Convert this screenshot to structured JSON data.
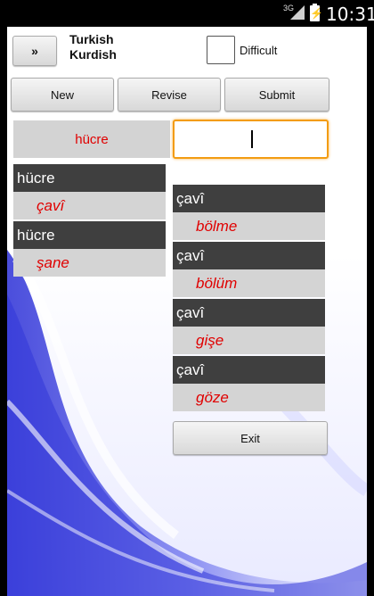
{
  "status_bar": {
    "network": "3G",
    "time": "10:31",
    "icons": [
      "signal-icon",
      "battery-charging-icon"
    ]
  },
  "header": {
    "nav_button_label": "»",
    "language_from": "Turkish",
    "language_to": "Kurdish",
    "difficult_label": "Difficult",
    "difficult_checked": false
  },
  "toolbar": {
    "new_label": "New",
    "revise_label": "Revise",
    "submit_label": "Submit"
  },
  "quiz": {
    "question": "hücre",
    "answer_value": ""
  },
  "left_list": [
    {
      "term": "hücre",
      "translation": "çavî"
    },
    {
      "term": "hücre",
      "translation": "şane"
    }
  ],
  "right_list": [
    {
      "term": "çavî",
      "translation": "bölme"
    },
    {
      "term": "çavî",
      "translation": "bölüm"
    },
    {
      "term": "çavî",
      "translation": "gişe"
    },
    {
      "term": "çavî",
      "translation": "göze"
    }
  ],
  "exit_label": "Exit",
  "colors": {
    "translation_text": "#e00000",
    "header_row_bg": "#3f3f3f",
    "input_focus": "#f39c12"
  }
}
